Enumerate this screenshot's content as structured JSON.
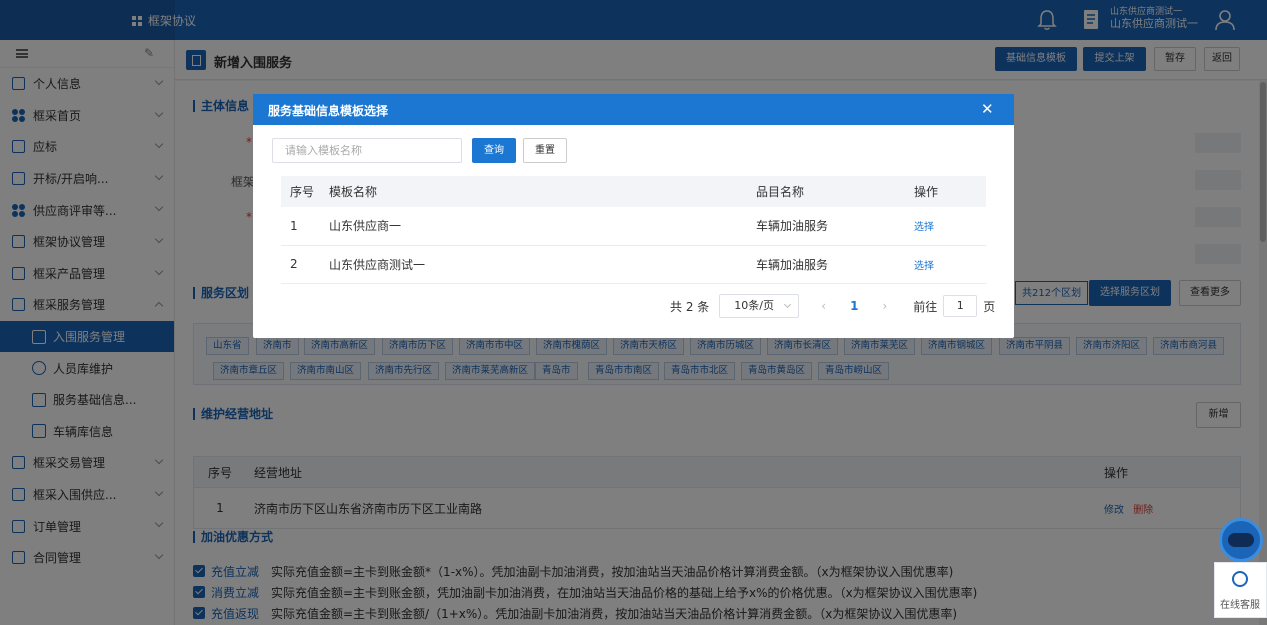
{
  "header": {
    "app_title": "框架协议",
    "user_line1": "山东供应商测试一",
    "user_line2": "山东供应商测试一"
  },
  "sidebar": {
    "items": [
      {
        "label": "个人信息",
        "icon": "person-card-icon"
      },
      {
        "label": "框采首页",
        "icon": "clover-icon"
      },
      {
        "label": "应标",
        "icon": "bid-icon"
      },
      {
        "label": "开标/开启响...",
        "icon": "open-bid-icon"
      },
      {
        "label": "供应商评审等...",
        "icon": "clover-icon"
      },
      {
        "label": "框架协议管理",
        "icon": "agreement-icon"
      },
      {
        "label": "框采产品管理",
        "icon": "product-icon"
      },
      {
        "label": "框采服务管理",
        "icon": "service-icon"
      },
      {
        "label": "框采交易管理",
        "icon": "trade-icon"
      },
      {
        "label": "框采入围供应...",
        "icon": "supplier-icon"
      },
      {
        "label": "订单管理",
        "icon": "order-icon"
      },
      {
        "label": "合同管理",
        "icon": "contract-icon"
      }
    ],
    "sub_items": [
      {
        "label": "入围服务管理",
        "icon": "doc-edit-icon"
      },
      {
        "label": "人员库维护",
        "icon": "person-icon"
      },
      {
        "label": "服务基础信息...",
        "icon": "doc-edit-icon"
      },
      {
        "label": "车辆库信息",
        "icon": "doc-edit-icon"
      }
    ]
  },
  "page": {
    "title": "新增入围服务",
    "buttons": {
      "template": "基础信息模板",
      "submit": "提交上架",
      "save_draft": "暂存",
      "back": "返回"
    },
    "sections": {
      "main_info": "主体信息",
      "service_region": "服务区划",
      "address": "维护经营地址",
      "discount": "加油优惠方式"
    },
    "form_labels": {
      "star": "*",
      "framework": "框架"
    },
    "region_summary": "共212个区划",
    "region_buttons": {
      "select": "选择服务区划",
      "more": "查看更多"
    },
    "regions": [
      "山东省",
      "济南市",
      "济南市高新区",
      "济南市历下区",
      "济南市市中区",
      "济南市槐荫区",
      "济南市天桥区",
      "济南市历城区",
      "济南市长清区",
      "济南市莱芜区",
      "济南市钢城区",
      "济南市平阴县",
      "济南市济阳区",
      "济南市商河县",
      "济南市章丘区",
      "济南市南山区",
      "济南市先行区",
      "济南市莱芜高新区",
      "青岛市",
      "青岛市市南区",
      "青岛市市北区",
      "青岛市黄岛区",
      "青岛市崂山区"
    ],
    "address_add": "新增",
    "address_table": {
      "headers": {
        "index": "序号",
        "address": "经营地址",
        "action": "操作"
      },
      "rows": [
        {
          "index": "1",
          "address": "济南市历下区山东省济南市历下区工业南路",
          "edit": "修改",
          "delete": "删除"
        }
      ]
    },
    "discounts": [
      {
        "label": "充值立减",
        "desc": "实际充值金额=主卡到账金额*（1-x%）。凭加油副卡加油消费，按加油站当天油品价格计算消费金额。（x为框架协议入围优惠率)"
      },
      {
        "label": "消费立减",
        "desc": "实际充值金额=主卡到账金额，凭加油副卡加油消费，在加油站当天油品价格的基础上给予x%的价格优惠。（x为框架协议入围优惠率)"
      },
      {
        "label": "充值返现",
        "desc": "实际充值金额=主卡到账金额/（1+x%）。凭加油副卡加油消费，按加油站当天油品价格计算消费金额。（x为框架协议入围优惠率)"
      }
    ]
  },
  "modal": {
    "title": "服务基础信息模板选择",
    "search_placeholder": "请输入模板名称",
    "query_label": "查询",
    "reset_label": "重置",
    "table": {
      "headers": {
        "index": "序号",
        "name": "模板名称",
        "category": "品目名称",
        "action": "操作"
      },
      "rows": [
        {
          "index": "1",
          "name": "山东供应商一",
          "category": "车辆加油服务",
          "action": "选择"
        },
        {
          "index": "2",
          "name": "山东供应商测试一",
          "category": "车辆加油服务",
          "action": "选择"
        }
      ]
    },
    "pager": {
      "total": "共 2 条",
      "page_size": "10条/页",
      "prev": "‹",
      "current": "1",
      "next": "›",
      "goto_label": "前往",
      "goto_value": "1",
      "page_suffix": "页"
    }
  },
  "float": {
    "customer_service": "在线客服"
  },
  "colors": {
    "brand": "#1b65b9",
    "modal_header": "#1b77d2",
    "delete": "#e53935"
  }
}
